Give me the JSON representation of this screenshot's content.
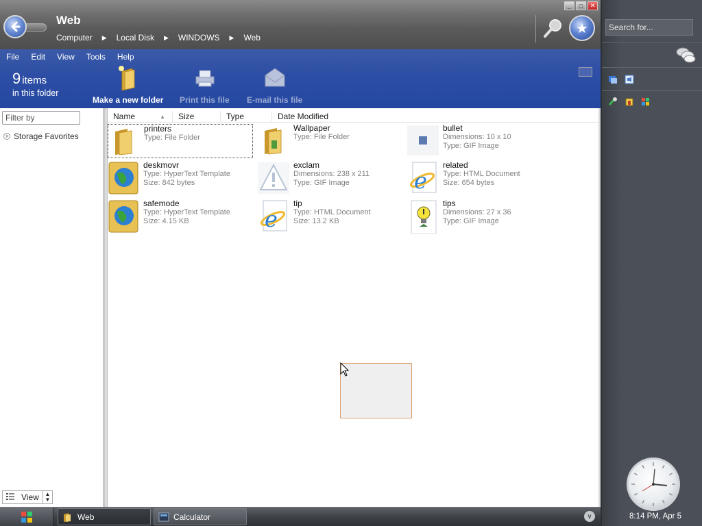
{
  "window": {
    "title": "Web",
    "breadcrumb": [
      "Computer",
      "Local Disk",
      "WINDOWS",
      "Web"
    ],
    "controls": [
      "minimize",
      "maximize",
      "close"
    ]
  },
  "menu": [
    "File",
    "Edit",
    "View",
    "Tools",
    "Help"
  ],
  "summary": {
    "count": "9",
    "word": "items",
    "sub": "in this folder"
  },
  "commands": [
    {
      "label": "Make a new folder",
      "icon": "new-folder-icon",
      "enabled": true
    },
    {
      "label": "Print this file",
      "icon": "printer-icon",
      "enabled": false
    },
    {
      "label": "E-mail this file",
      "icon": "email-icon",
      "enabled": false
    }
  ],
  "leftpane": {
    "filter_placeholder": "Filter by",
    "tree_item": "Storage Favorites",
    "view_label": "View"
  },
  "columns": [
    "Name",
    "Size",
    "Type",
    "Date Modified"
  ],
  "files": [
    {
      "name": "printers",
      "line1": "Type: File Folder",
      "line2": "",
      "icon": "folder-icon"
    },
    {
      "name": "Wallpaper",
      "line1": "Type: File Folder",
      "line2": "",
      "icon": "folder-icon"
    },
    {
      "name": "bullet",
      "line1": "Dimensions: 10 x 10",
      "line2": "Type: GIF Image",
      "icon": "gif-bullet-icon"
    },
    {
      "name": "deskmovr",
      "line1": "Type: HyperText Template",
      "line2": "Size: 842 bytes",
      "icon": "globe-icon"
    },
    {
      "name": "exclam",
      "line1": "Dimensions: 238 x 211",
      "line2": "Type: GIF Image",
      "icon": "warning-icon"
    },
    {
      "name": "related",
      "line1": "Type: HTML Document",
      "line2": "Size: 654 bytes",
      "icon": "ie-icon"
    },
    {
      "name": "safemode",
      "line1": "Type: HyperText Template",
      "line2": "Size: 4.15 KB",
      "icon": "globe-icon"
    },
    {
      "name": "tip",
      "line1": "Type: HTML Document",
      "line2": "Size: 13.2 KB",
      "icon": "ie-icon"
    },
    {
      "name": "tips",
      "line1": "Dimensions: 27 x 36",
      "line2": "Type: GIF Image",
      "icon": "tip-bulb-icon"
    }
  ],
  "sidebar": {
    "search_placeholder": "Search for...",
    "clock_time": "8:14 PM, Apr 5"
  },
  "taskbar": {
    "tasks": [
      {
        "label": "Web",
        "icon": "folder-icon",
        "active": true
      },
      {
        "label": "Calculator",
        "icon": "calculator-icon",
        "active": false
      }
    ]
  },
  "colors": {
    "band": "#2e4fa5",
    "titlebar": "#6e6e6e",
    "sidebar": "#4b5058"
  }
}
